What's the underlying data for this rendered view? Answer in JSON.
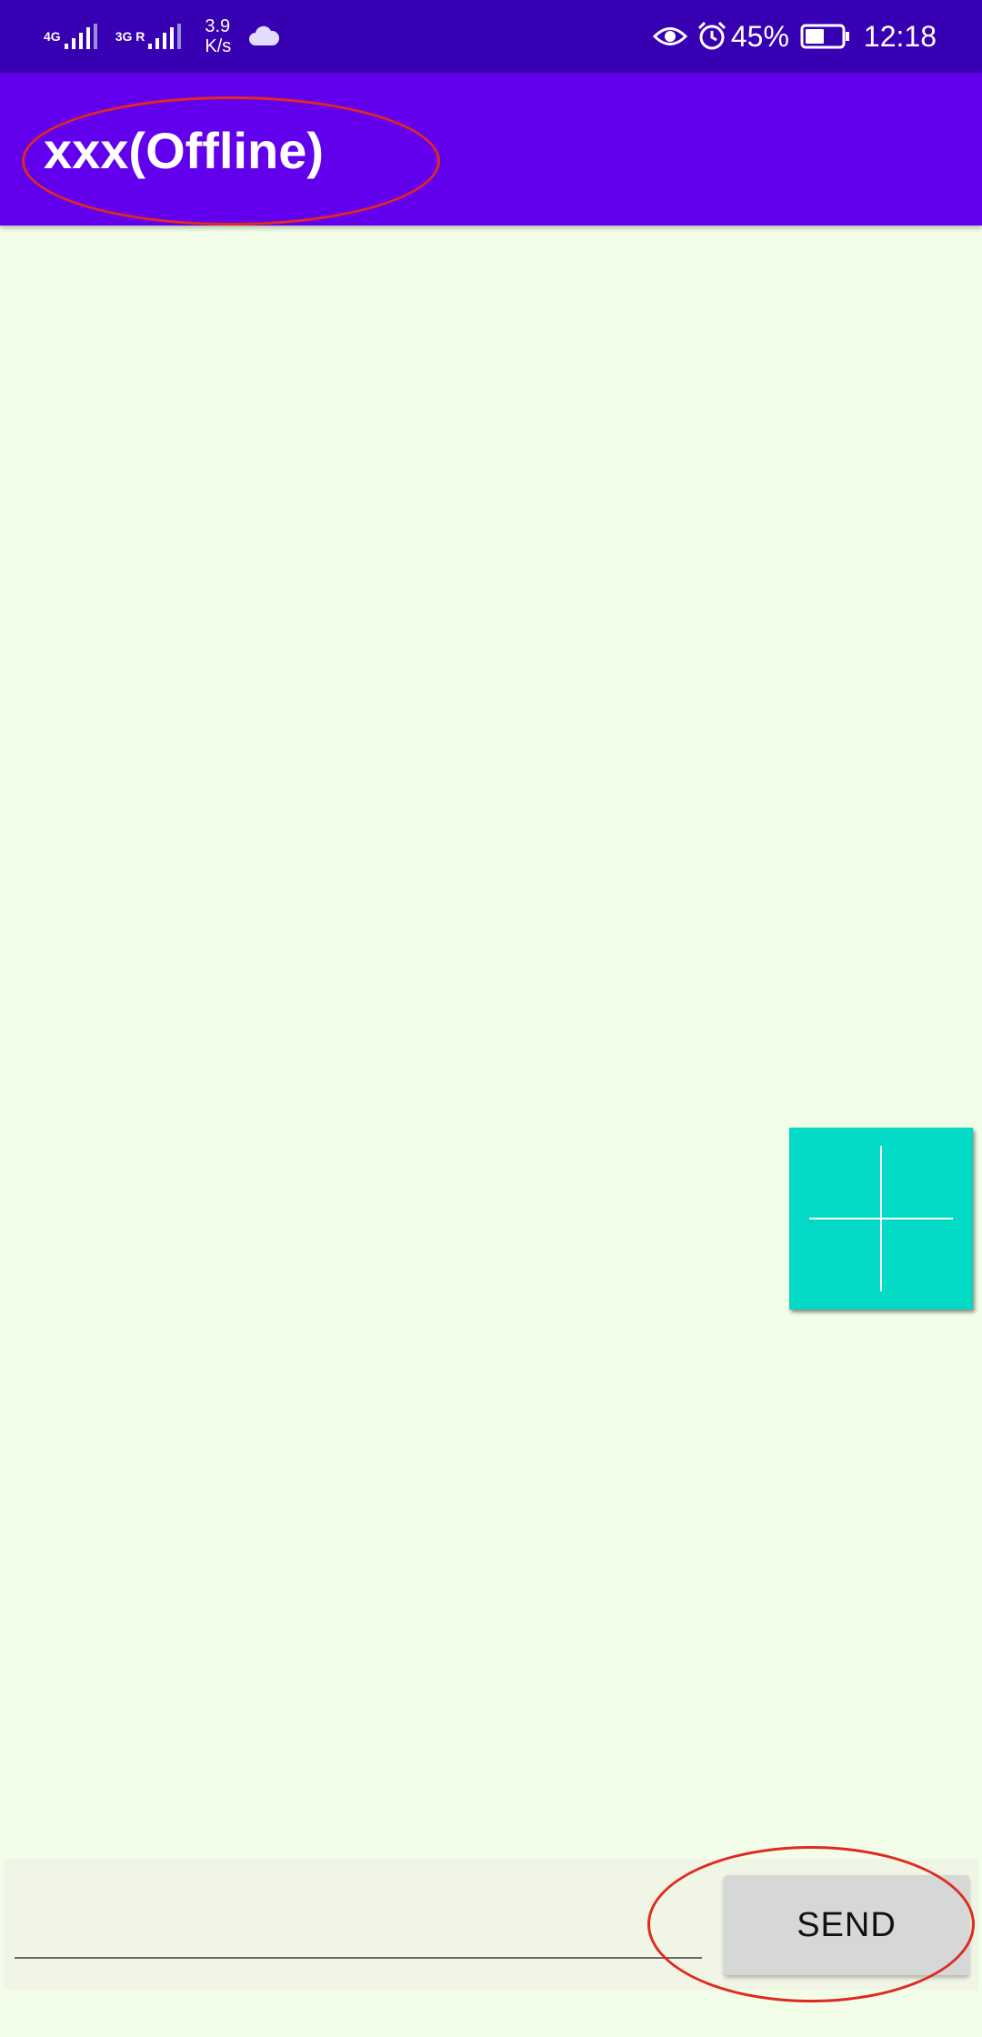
{
  "status_bar": {
    "network_1": "4G",
    "network_2": "3G R",
    "speed_value": "3.9",
    "speed_unit": "K/s",
    "battery_percent": "45%",
    "time": "12:18"
  },
  "app_bar": {
    "title": "xxx(Offline)"
  },
  "composer": {
    "input_value": "",
    "send_label": "SEND"
  },
  "colors": {
    "status_bar": "#3700b3",
    "app_bar": "#6200ee",
    "background": "#f2fee8",
    "fab": "#03dac5",
    "annotation": "#e02a20"
  },
  "icons": {
    "fab": "plus-icon",
    "status": [
      "signal-icon",
      "cloud-icon",
      "eye-icon",
      "alarm-icon",
      "battery-icon"
    ]
  }
}
